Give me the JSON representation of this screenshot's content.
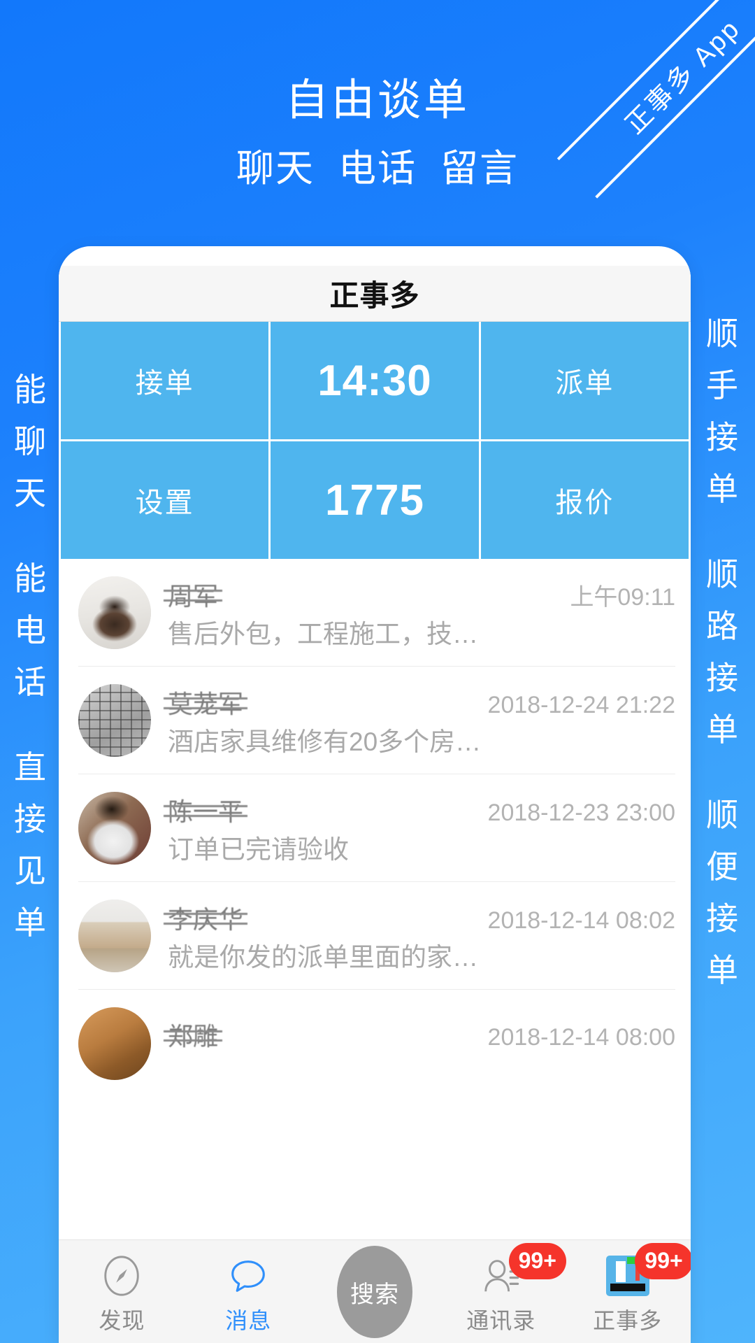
{
  "ribbon": {
    "text": "正事多 App"
  },
  "headline": {
    "main": "自由谈单",
    "sub_1": "聊天",
    "sub_2": "电话",
    "sub_3": "留言"
  },
  "side_left": {
    "phrases": [
      {
        "chars": [
          "能",
          "聊",
          "天"
        ]
      },
      {
        "chars": [
          "能",
          "电",
          "话"
        ]
      },
      {
        "chars": [
          "直",
          "接",
          "见",
          "单"
        ]
      }
    ]
  },
  "side_right": {
    "phrases": [
      {
        "chars": [
          "顺",
          "手",
          "接",
          "单"
        ]
      },
      {
        "chars": [
          "顺",
          "路",
          "接",
          "单"
        ]
      },
      {
        "chars": [
          "顺",
          "便",
          "接",
          "单"
        ]
      }
    ]
  },
  "phone": {
    "app_title": "正事多",
    "grid": [
      {
        "text": "接单",
        "kind": "label"
      },
      {
        "text": "14:30",
        "kind": "value"
      },
      {
        "text": "派单",
        "kind": "label"
      },
      {
        "text": "设置",
        "kind": "label"
      },
      {
        "text": "1775",
        "kind": "value"
      },
      {
        "text": "报价",
        "kind": "label"
      }
    ],
    "messages": [
      {
        "name": "周军",
        "time": "上午09:11",
        "preview": "售后外包，工程施工，技…"
      },
      {
        "name": "莫茏军",
        "time": "2018-12-24 21:22",
        "preview": "酒店家具维修有20多个房…"
      },
      {
        "name": "陈一平",
        "time": "2018-12-23 23:00",
        "preview": "订单已完请验收"
      },
      {
        "name": "李庆华",
        "time": "2018-12-14 08:02",
        "preview": "就是你发的派单里面的家…"
      },
      {
        "name": "郑雕",
        "time": "2018-12-14 08:00",
        "preview": ""
      }
    ],
    "tabs": [
      {
        "label": "发现",
        "icon": "compass-icon",
        "active": false,
        "badge": ""
      },
      {
        "label": "消息",
        "icon": "chat-icon",
        "active": true,
        "badge": ""
      },
      {
        "label": "搜索",
        "icon": "search-icon",
        "active": false,
        "badge": ""
      },
      {
        "label": "通讯录",
        "icon": "contacts-icon",
        "active": false,
        "badge": "99+"
      },
      {
        "label": "正事多",
        "icon": "app-icon",
        "active": false,
        "badge": "99+"
      }
    ]
  },
  "colors": {
    "bg_blue_dark": "#1278fb",
    "bg_blue_light": "#4fb4fc",
    "grid_cell": "#4fb5ee",
    "accent_blue": "#2f8ffb",
    "badge_red": "#f5342b",
    "tabbar_bg": "#f5f5f5"
  }
}
